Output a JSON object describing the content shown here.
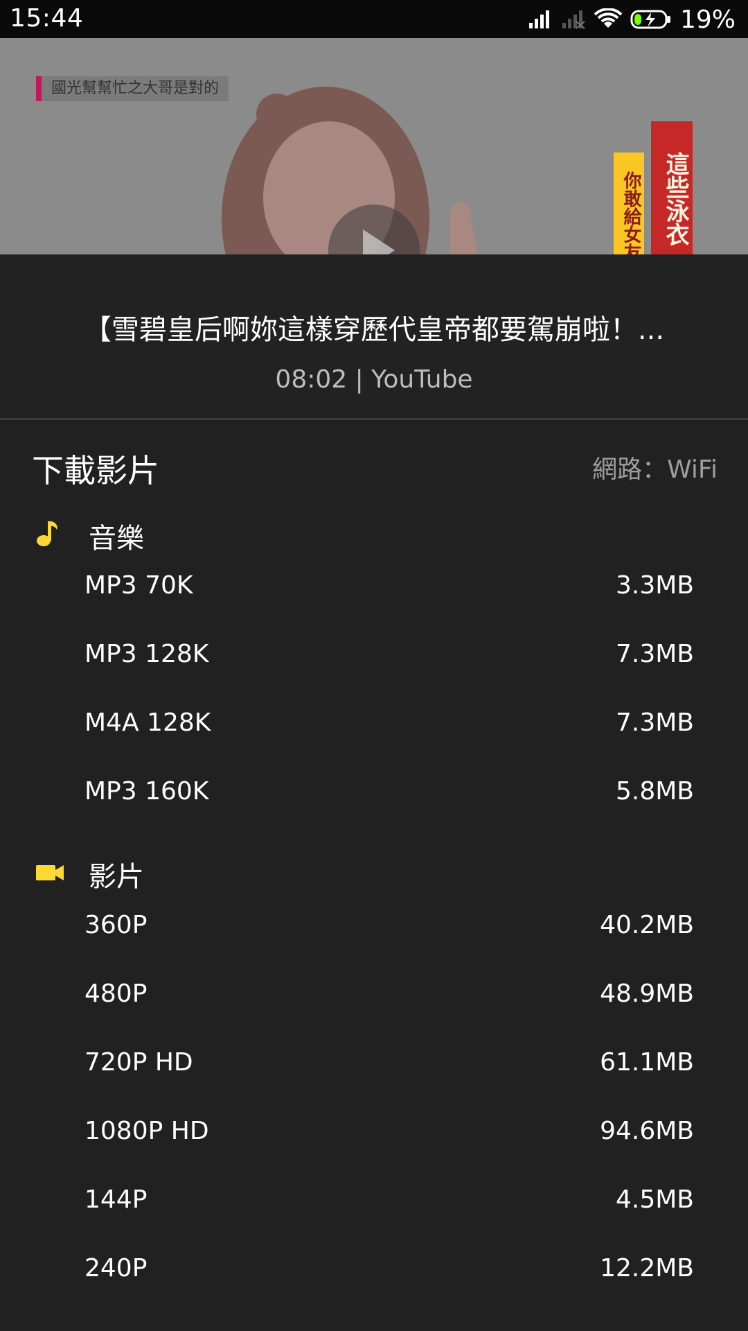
{
  "status_bar": {
    "time": "15:44",
    "battery": "19%"
  },
  "video": {
    "overlay_caption": "國光幫幫忙之大哥是對的",
    "banner_red": "這些泳衣",
    "banner_yellow": "你敢給女友"
  },
  "info": {
    "title": "【雪碧皇后啊妳這樣穿歷代皇帝都要駕崩啦！...",
    "meta": "08:02 | YouTube"
  },
  "download": {
    "title": "下載影片",
    "network": "網路：WiFi"
  },
  "music": {
    "label": "音樂",
    "items": [
      {
        "format": "MP3 70K",
        "size": "3.3MB"
      },
      {
        "format": "MP3 128K",
        "size": "7.3MB"
      },
      {
        "format": "M4A 128K",
        "size": "7.3MB"
      },
      {
        "format": "MP3 160K",
        "size": "5.8MB"
      }
    ]
  },
  "videos": {
    "label": "影片",
    "items": [
      {
        "format": "360P",
        "size": "40.2MB"
      },
      {
        "format": "480P",
        "size": "48.9MB"
      },
      {
        "format": "720P HD",
        "size": "61.1MB"
      },
      {
        "format": "1080P HD",
        "size": "94.6MB"
      },
      {
        "format": "144P",
        "size": "4.5MB"
      },
      {
        "format": "240P",
        "size": "12.2MB"
      }
    ]
  },
  "colors": {
    "accent": "#fdd835",
    "background": "#212121"
  }
}
